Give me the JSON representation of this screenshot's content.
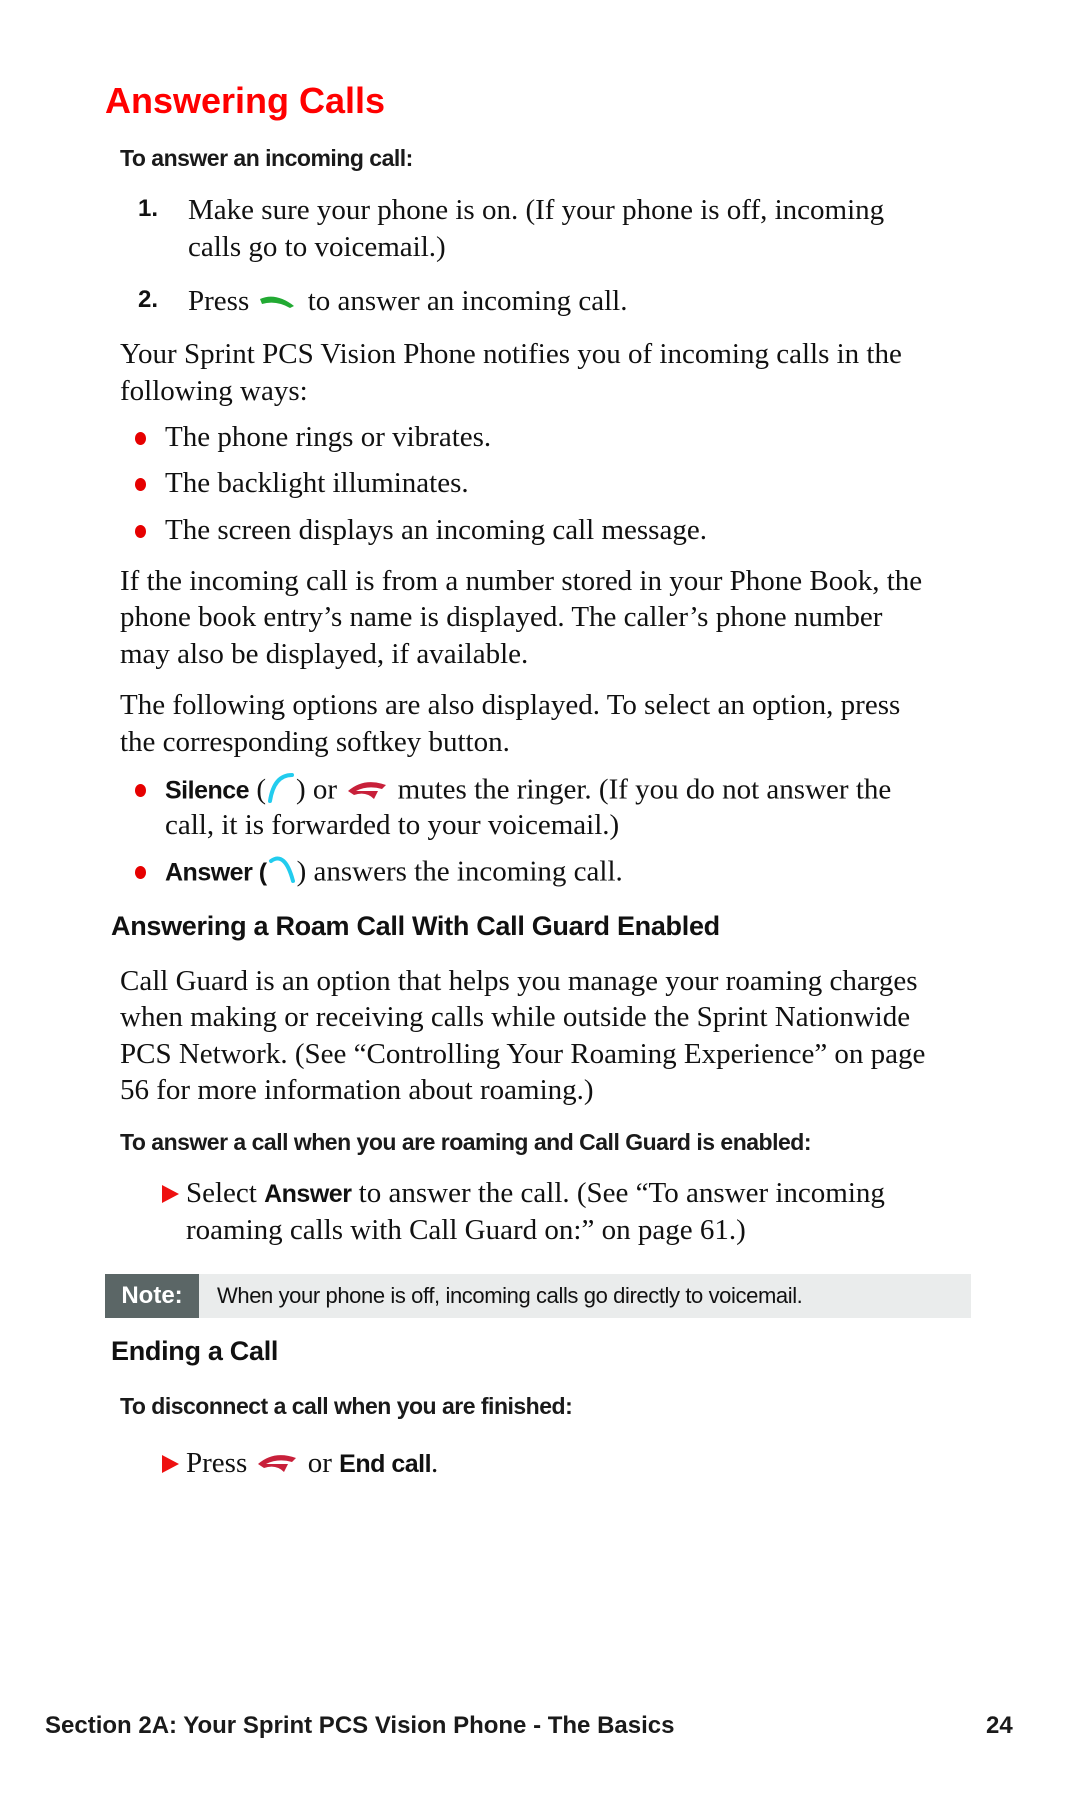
{
  "title": "Answering Calls",
  "section1": {
    "subheading": "To answer an incoming call:",
    "steps": [
      {
        "num": "1.",
        "line1": "Make sure your phone is on. (If your phone is off, incoming",
        "line2": "calls go to voicemail.)"
      },
      {
        "num": "2.",
        "pre": "Press",
        "icon": "talk-key-icon",
        "post": "to answer an incoming call."
      }
    ],
    "para1": [
      "Your Sprint PCS Vision Phone notifies you of incoming calls in the",
      "following ways:"
    ],
    "bullets": [
      "The phone rings or vibrates.",
      "The backlight illuminates.",
      "The screen displays an incoming call message."
    ],
    "para2": [
      "If the incoming call is from a number stored in your Phone Book, the",
      "phone book entry’s name is displayed. The caller’s phone number",
      "may also be displayed, if available."
    ],
    "para3": [
      "The following options are also displayed. To select an option, press",
      "the corresponding softkey button."
    ],
    "options": [
      {
        "keyword": "Silence",
        "open": "(",
        "close": ") or",
        "rest1": "mutes the ringer. (If you do not answer the",
        "rest2": "call, it is forwarded to your voicemail.)"
      },
      {
        "keyword": "Answer (",
        "close": ") answers the incoming call."
      }
    ]
  },
  "section2": {
    "heading": "Answering a Roam Call With Call Guard Enabled",
    "para": [
      "Call Guard is an option that helps you manage your roaming charges",
      "when making or receiving calls while outside the Sprint Nationwide",
      "PCS Network. (See “Controlling Your Roaming Experience” on page",
      "56 for more information about roaming.)"
    ],
    "subheading": "To answer a call when you are roaming and Call Guard is enabled:",
    "step": {
      "pre": "Select",
      "keyword": "Answer",
      "line1rest": "to answer the call. (See “To answer incoming",
      "line2": "roaming calls with Call Guard on:” on page 61.)"
    }
  },
  "note": {
    "label": "Note:",
    "text": "When your phone is off, incoming calls go directly to voicemail."
  },
  "section3": {
    "heading": "Ending a Call",
    "subheading": "To disconnect a call when you are finished:",
    "step": {
      "pre": "Press",
      "mid": "or",
      "keyword": "End call",
      "end": "."
    }
  },
  "footer": {
    "section": "Section 2A: Your Sprint PCS Vision Phone - The Basics",
    "page": "24"
  },
  "colors": {
    "heading": "#ff0000",
    "bullet": "#e60000",
    "talk_key": "#22aa33",
    "softkey": "#22ccee",
    "end_key": "#c8203a",
    "note_label_bg": "#5b6666",
    "note_bg": "#eaecec"
  }
}
